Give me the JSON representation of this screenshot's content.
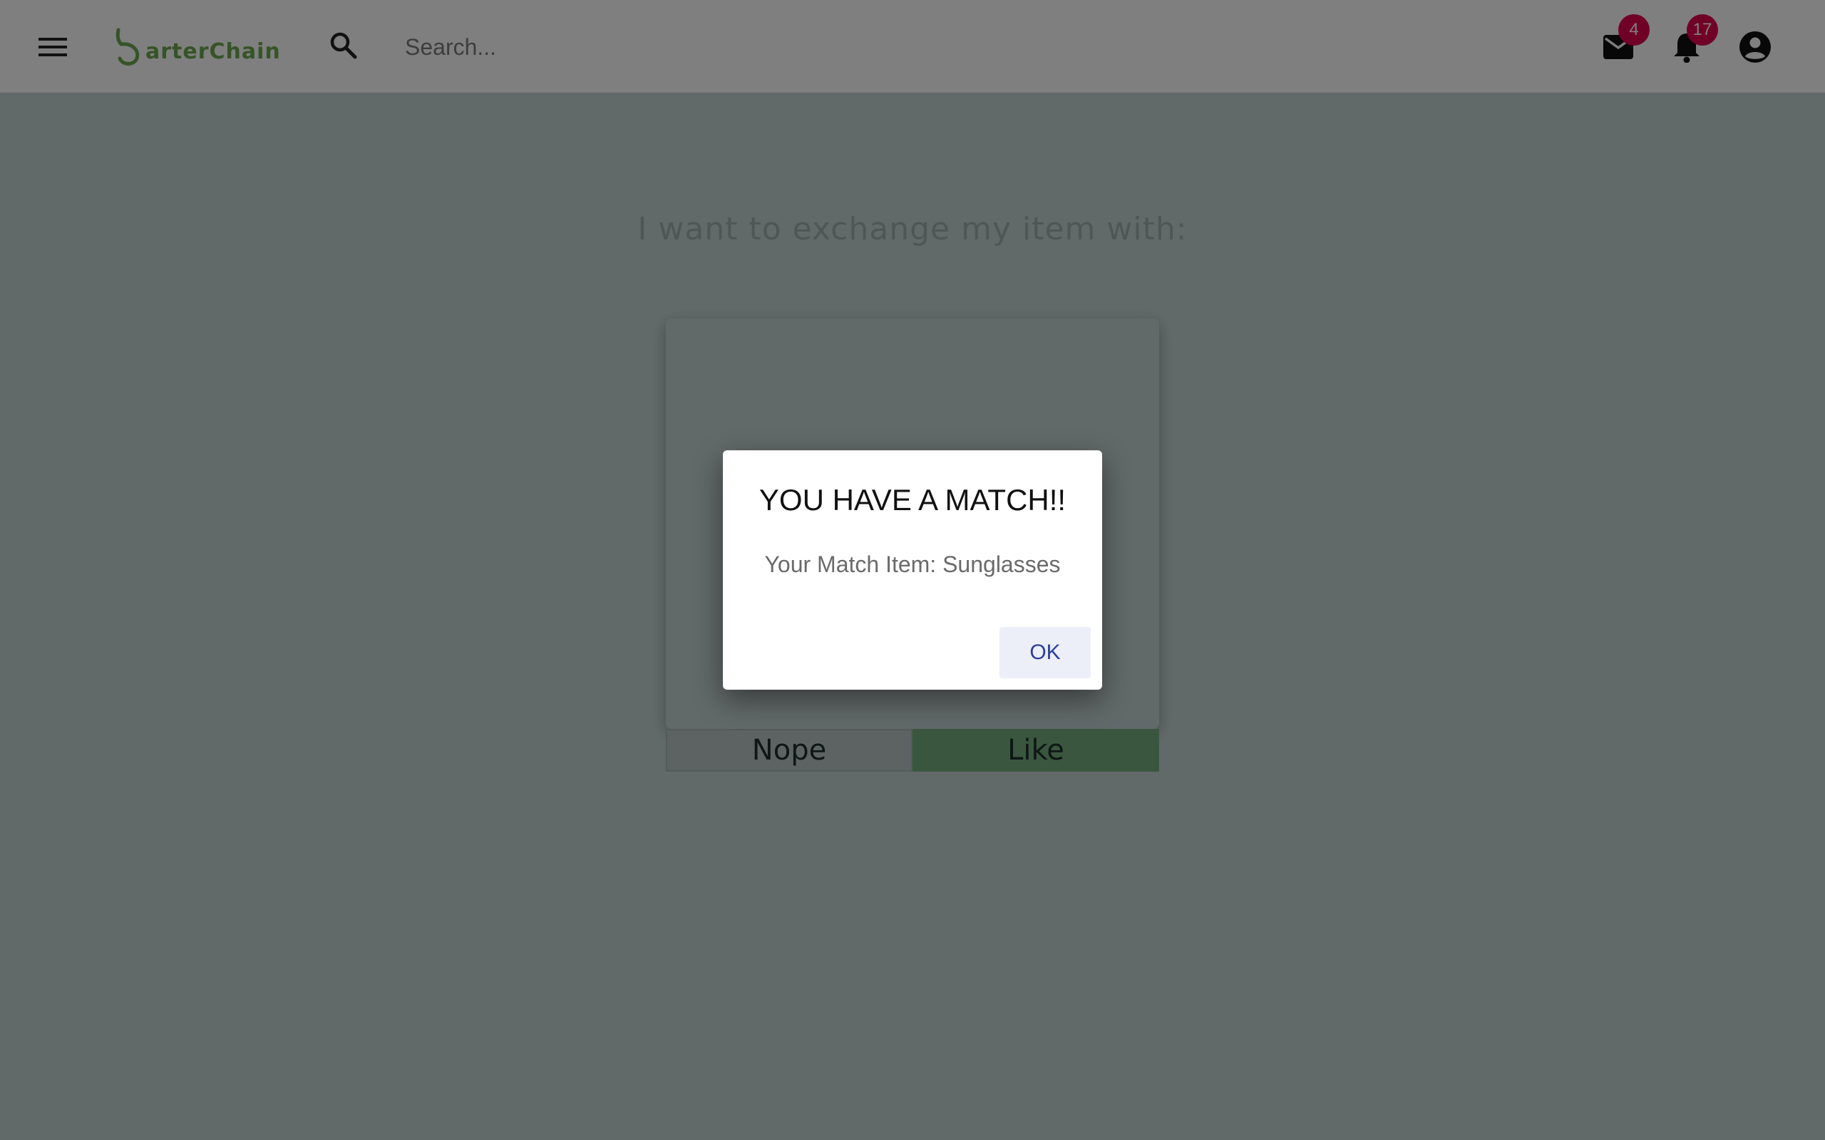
{
  "appbar": {
    "logo_text": "arterChain",
    "search_placeholder": "Search...",
    "mail_count": "4",
    "notification_count": "17"
  },
  "main": {
    "heading": "I want to exchange my item with:",
    "nope_label": "Nope",
    "like_label": "Like"
  },
  "dialog": {
    "title": "YOU HAVE A MATCH!!",
    "message": "Your Match Item: Sunglasses",
    "ok_label": "OK"
  },
  "colors": {
    "brand_green": "#6aa84f",
    "badge": "#e3004c",
    "like_button": "#8bc884",
    "nope_button": "#efebea",
    "ok_text": "#2a3f9a"
  },
  "icons": [
    "menu-icon",
    "logo-swoosh-icon",
    "search-icon",
    "mail-icon",
    "bell-icon",
    "account-circle-icon"
  ]
}
